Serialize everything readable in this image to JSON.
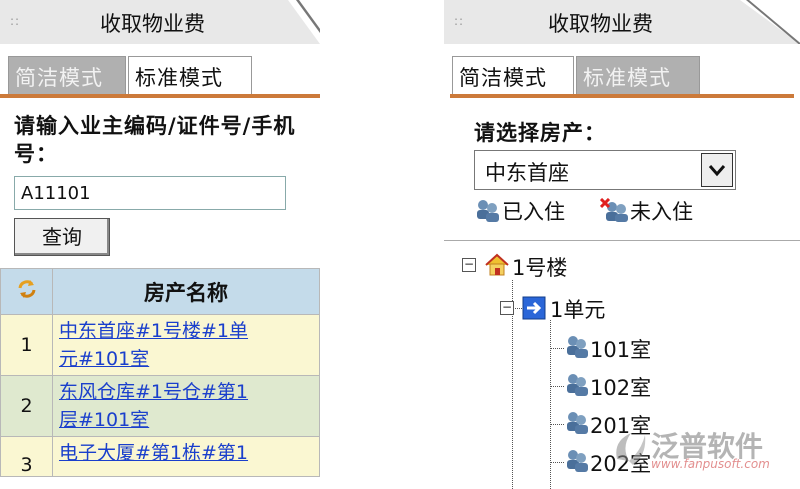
{
  "left_panel": {
    "header": {
      "grip": "::",
      "title": "收取物业费"
    },
    "tabs": [
      {
        "label": "简洁模式",
        "active": false
      },
      {
        "label": "标准模式",
        "active": true
      }
    ],
    "search": {
      "prompt": "请输入业主编码/证件号/手机号：",
      "value": "A11101",
      "button_label": "查询"
    },
    "table": {
      "header_name": "房产名称",
      "rows": [
        {
          "index": "1",
          "name_line1": "中东首座#1号楼#1单",
          "name_line2": "元#101室"
        },
        {
          "index": "2",
          "name_line1": "东风仓库#1号仓#第1",
          "name_line2": "层#101室"
        },
        {
          "index": "3",
          "name_line1": "电子大厦#第1栋#第1",
          "name_line2": ""
        }
      ]
    }
  },
  "right_panel": {
    "header": {
      "grip": "::",
      "title": "收取物业费"
    },
    "tabs": [
      {
        "label": "简洁模式",
        "active": true
      },
      {
        "label": "标准模式",
        "active": false
      }
    ],
    "select_label": "请选择房产：",
    "selected_property": "中东首座",
    "legend": {
      "occupied": "已入住",
      "vacant": "未入住"
    },
    "tree": {
      "building": "1号楼",
      "unit": "1单元",
      "rooms": [
        "101室",
        "102室",
        "201室",
        "202室"
      ]
    }
  },
  "watermark": {
    "text": "泛普软件",
    "url": "www.fanpusoft.com"
  },
  "colors": {
    "accent_line": "#cc7a3a",
    "link": "#1a3fcc",
    "table_header": "#c4dbea",
    "row_odd": "#faf7d2",
    "row_even": "#dfe9cf"
  }
}
